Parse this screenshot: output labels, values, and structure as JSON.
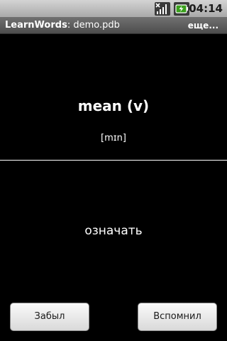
{
  "status_bar": {
    "time": "04:14",
    "icons": [
      "no-signal-icon",
      "battery-charging-icon"
    ],
    "colors": {
      "background": "#bfbfbf",
      "text": "#1c1c1c",
      "battery": "#3aa01c"
    }
  },
  "title_bar": {
    "app_name": "LearnWords",
    "separator": ": ",
    "file": "demo.pdb",
    "more_label": "еще..."
  },
  "card": {
    "word": "mean (v)",
    "transcription": "[mɪn]",
    "translation": "означать"
  },
  "buttons": {
    "forgot_label": "Забыл",
    "remembered_label": "Вспомнил"
  }
}
